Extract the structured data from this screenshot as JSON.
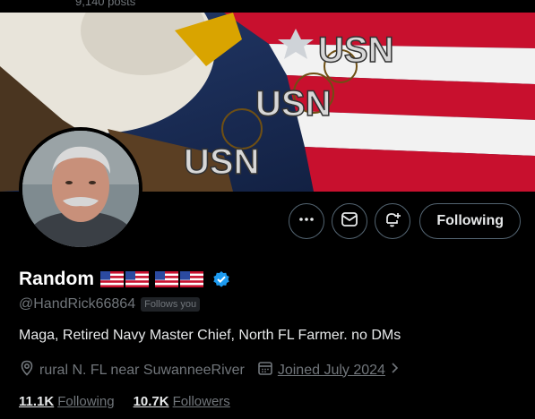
{
  "header": {
    "post_count": "9,140 posts"
  },
  "banner": {
    "texts": [
      "USN",
      "USN",
      "USN"
    ]
  },
  "actions": {
    "more_icon": "more-horizontal-icon",
    "message_icon": "envelope-icon",
    "notify_icon": "bell-plus-icon",
    "following_label": "Following"
  },
  "profile": {
    "display_name": "Random",
    "flags": [
      "us-flag",
      "us-flag",
      "us-flag",
      "us-flag"
    ],
    "verified_color": "#1d9bf0",
    "handle": "@HandRick66864",
    "follows_you": "Follows you",
    "bio": "Maga, Retired Navy Master Chief, North FL Farmer. no DMs",
    "location": "rural N. FL near SuwanneeRiver",
    "joined": "Joined July 2024"
  },
  "stats": {
    "following_count": "11.1K",
    "following_label": "Following",
    "followers_count": "10.7K",
    "followers_label": "Followers"
  }
}
